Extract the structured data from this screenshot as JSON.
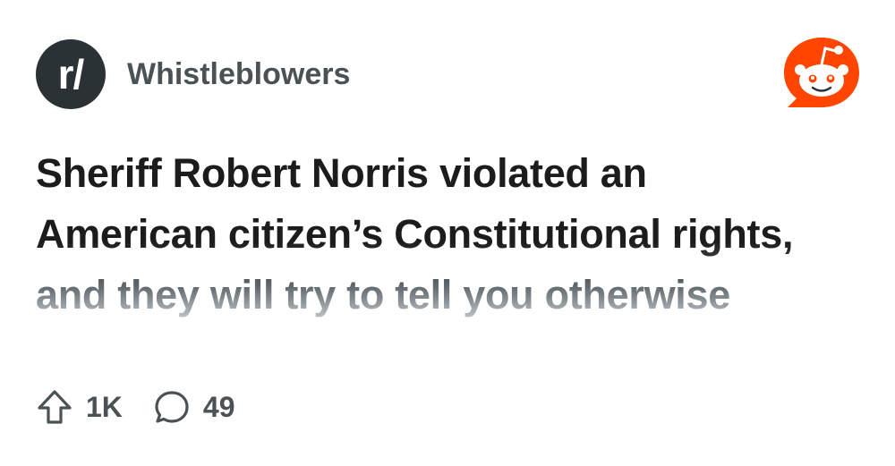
{
  "header": {
    "subreddit_prefix": "r/",
    "subreddit_name": "Whistleblowers",
    "subreddit_icon": "subreddit-prefix-icon",
    "brand_icon": "reddit-snoo-icon"
  },
  "post": {
    "title": "Sheriff Robert Norris violated an American citizen’s Constitutional rights, and they will try to tell you otherwise"
  },
  "stats": {
    "upvotes": "1K",
    "upvote_icon": "upvote-arrow-icon",
    "comments": "49",
    "comment_icon": "comment-bubble-icon"
  },
  "colors": {
    "brand_orange": "#ff4500",
    "subreddit_icon_bg": "#2a3236",
    "muted_text": "#4a5256",
    "title_text": "#1c1c1c"
  }
}
